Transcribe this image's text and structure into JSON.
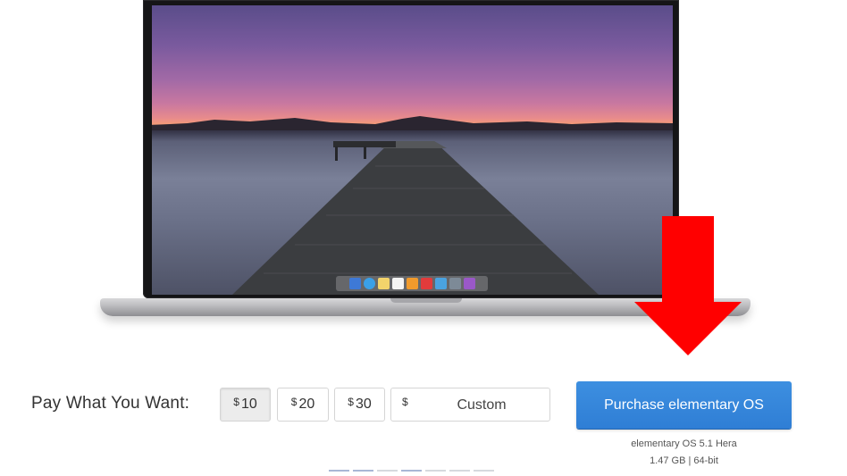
{
  "payment": {
    "label": "Pay What You Want:",
    "currency_symbol": "$",
    "amounts": [
      {
        "value": "10",
        "selected": true
      },
      {
        "value": "20",
        "selected": false
      },
      {
        "value": "30",
        "selected": false
      }
    ],
    "custom_placeholder": "Custom"
  },
  "purchase": {
    "button_label": "Purchase elementary OS",
    "release_name": "elementary OS 5.1 Hera",
    "release_details": "1.47 GB | 64-bit"
  },
  "colors": {
    "accent": "#3389dc",
    "arrow": "#ff0000"
  },
  "dock": {
    "icons": [
      "files-icon",
      "web-browser-icon",
      "mail-icon",
      "calendar-icon",
      "music-icon",
      "videos-icon",
      "photos-icon",
      "settings-icon",
      "appcenter-icon"
    ]
  }
}
